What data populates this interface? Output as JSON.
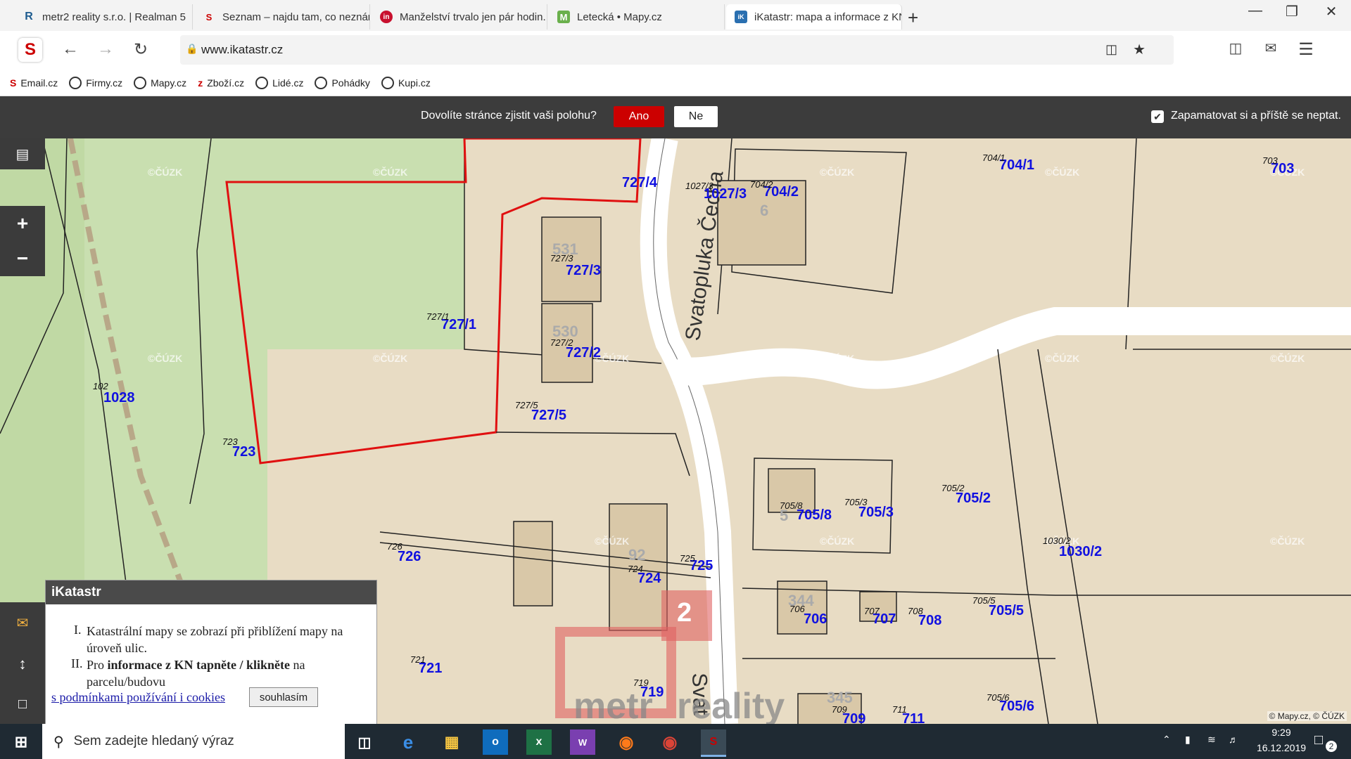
{
  "tabs": [
    {
      "label": "metr2 reality s.r.o. | Realman 5",
      "icon": "R",
      "icon_color": "#1d5b8f"
    },
    {
      "label": "Seznam – najdu tam, co neznám",
      "icon": "S",
      "icon_color": "#cc0000"
    },
    {
      "label": "Manželství trvalo jen pár hodin. S",
      "icon": "in",
      "icon_color": "#c8102e"
    },
    {
      "label": "Letecká • Mapy.cz",
      "icon": "M",
      "icon_color": "#6ab04c"
    },
    {
      "label": "iKatastr: mapa a informace z KN",
      "icon": "iK",
      "icon_color": "#2a6fb0"
    }
  ],
  "address": {
    "url": "www.ikatastr.cz"
  },
  "bookmarks": [
    "Email.cz",
    "Firmy.cz",
    "Mapy.cz",
    "Zboží.cz",
    "Lidé.cz",
    "Pohádky",
    "Kupi.cz"
  ],
  "geo_prompt": {
    "question": "Dovolíte stránce zjistit vaši polohu?",
    "yes": "Ano",
    "no": "Ne",
    "remember": "Zapamatovat si a příště se neptat."
  },
  "map": {
    "street_labels": [
      "Svatopluka Čecha",
      "Svat"
    ],
    "parcels": [
      "727/4",
      "1027/3",
      "704/2",
      "704/1",
      "703",
      "727/3",
      "727/1",
      "727/2",
      "1028",
      "727/5",
      "723",
      "705/8",
      "705/3",
      "705/2",
      "1030/2",
      "726",
      "724",
      "725",
      "706",
      "707",
      "708",
      "705/5",
      "721",
      "719",
      "709",
      "711",
      "705/6"
    ],
    "small_labels": [
      "1027/3",
      "704/2",
      "704/1",
      "703",
      "727/3",
      "727/1",
      "727/2",
      "102",
      "727/5",
      "723",
      "705/8",
      "705/3",
      "705/2",
      "1030/2",
      "726",
      "724",
      "725",
      "706",
      "707",
      "708",
      "705/5",
      "721",
      "719",
      "709",
      "711",
      "705/6"
    ],
    "building_numbers": [
      "531",
      "530",
      "6",
      "5",
      "92",
      "344",
      "345"
    ],
    "watermark": "©ČÚZK",
    "attribution": "© Mapy.cz, © ČÚZK",
    "overlay_number": "2",
    "overlay_logo_left": "metr",
    "overlay_logo_right": "reality"
  },
  "info_panel": {
    "title": "iKatastr",
    "item1_num": "I.",
    "item1": "Katastrální mapy se zobrazí při přiblížení mapy na úroveň ulic.",
    "item2_num": "II.",
    "item2_pre": "Pro ",
    "item2_bold": "informace z KN tapněte / klikněte",
    "item2_post": " na parcelu/budovu",
    "link": "s podmínkami používání i cookies",
    "agree": "souhlasím"
  },
  "controls": {
    "zoom_in": "+",
    "zoom_out": "−"
  },
  "taskbar": {
    "search_placeholder": "Sem zadejte hledaný výraz",
    "time": "9:29",
    "date": "16.12.2019",
    "notifications": "2"
  },
  "colors": {
    "accent_red": "#cc0000",
    "parcel_label": "#1010e0",
    "selected_parcel_outline": "#e01010",
    "map_bg": "#e8dcc4",
    "green_area": "#c9dfb0"
  }
}
